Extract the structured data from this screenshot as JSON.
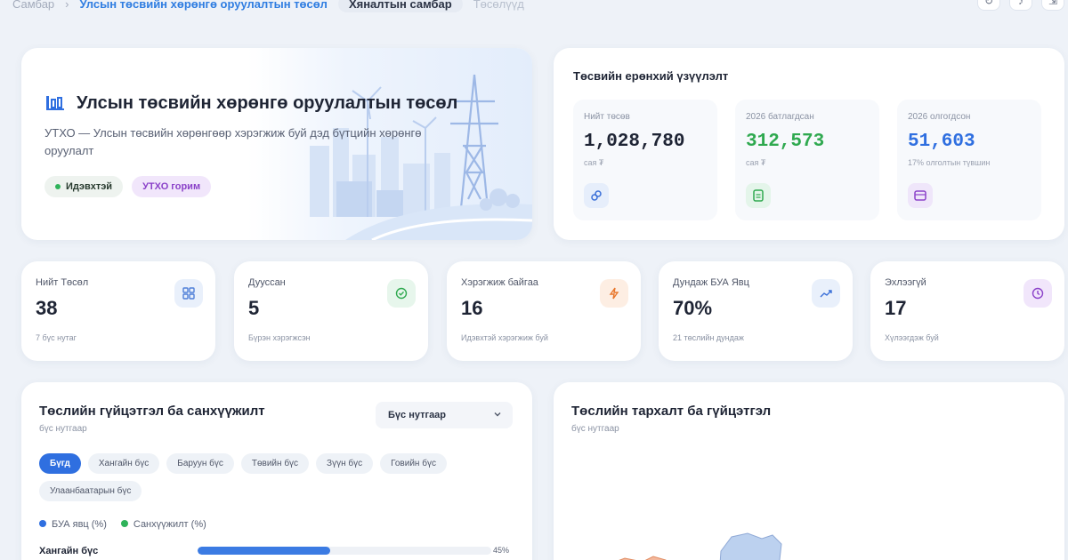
{
  "topbar": {
    "home": "Самбар",
    "active": "Улсын төсвийн хөрөнгө оруулалтын төсөл",
    "pill": "Хяналтын самбар",
    "faded": "Төсөлүүд"
  },
  "hero": {
    "title": "Улсын төсвийн хөрөнгө оруулалтын төсөл",
    "description": "УТХО — Улсын төсвийн хөрөнгөөр хэрэгжиж буй дэд бүтцийн хөрөнгө оруулалт",
    "badge_active": "Идэвхтэй",
    "badge_mode": "УТХО горим"
  },
  "budget": {
    "title": "Төсвийн ерөнхий үзүүлэлт",
    "cards": [
      {
        "label": "Нийт төсөв",
        "value": "1,028,780",
        "sub": "сая ₮",
        "color": "#1e2434",
        "icon": "link-icon"
      },
      {
        "label": "2026 батлагдсан",
        "value": "312,573",
        "sub": "сая ₮",
        "color": "#2fa94f",
        "icon": "document-icon"
      },
      {
        "label": "2026 олгогдсон",
        "value": "51,603",
        "sub": "17% олголтын түвшин",
        "color": "#2f6fe0",
        "icon": "card-icon"
      }
    ]
  },
  "stats": [
    {
      "label": "Нийт Төсөл",
      "value": "38",
      "sub": "7 бүс нутаг",
      "icon": "grid-icon",
      "color": "#4f7fd8",
      "bg": "#e9f0fb"
    },
    {
      "label": "Дууссан",
      "value": "5",
      "sub": "Бүрэн хэрэгжсэн",
      "icon": "check-circle-icon",
      "color": "#2fa94f",
      "bg": "#e7f6ec"
    },
    {
      "label": "Хэрэгжиж байгаа",
      "value": "16",
      "sub": "Идэвхтэй хэрэгжиж буй",
      "icon": "lightning-icon",
      "color": "#e8772c",
      "bg": "#fdeee3"
    },
    {
      "label": "Дундаж БУА Явц",
      "value": "70%",
      "sub": "21 төслийн дундаж",
      "icon": "trend-up-icon",
      "color": "#3a6fd8",
      "bg": "#e9f0fb"
    },
    {
      "label": "Эхлээгүй",
      "value": "17",
      "sub": "Хүлээгдэж буй",
      "icon": "clock-icon",
      "color": "#8b42c9",
      "bg": "#f1e6fb"
    }
  ],
  "performance": {
    "title": "Төслийн гүйцэтгэл ба санхүүжилт",
    "subtitle": "бүс нутгаар",
    "select_value": "Бүс нутгаар",
    "chips": [
      "Бүгд",
      "Хангайн бүс",
      "Баруун бүс",
      "Төвийн бүс",
      "Зүүн бүс",
      "Говийн бүс",
      "Улаанбаатарын бүс"
    ],
    "legend": [
      {
        "label": "БУА явц (%)",
        "color": "#2f6fe0"
      },
      {
        "label": "Санхүүжилт (%)",
        "color": "#2fb35a"
      }
    ],
    "rows": [
      {
        "label": "Хангайн бүс",
        "progress": 45,
        "progress_text": "45%"
      }
    ]
  },
  "distribution": {
    "title": "Төслийн тархалт ба гүйцэтгэл",
    "subtitle": "бүс нутгаар"
  }
}
